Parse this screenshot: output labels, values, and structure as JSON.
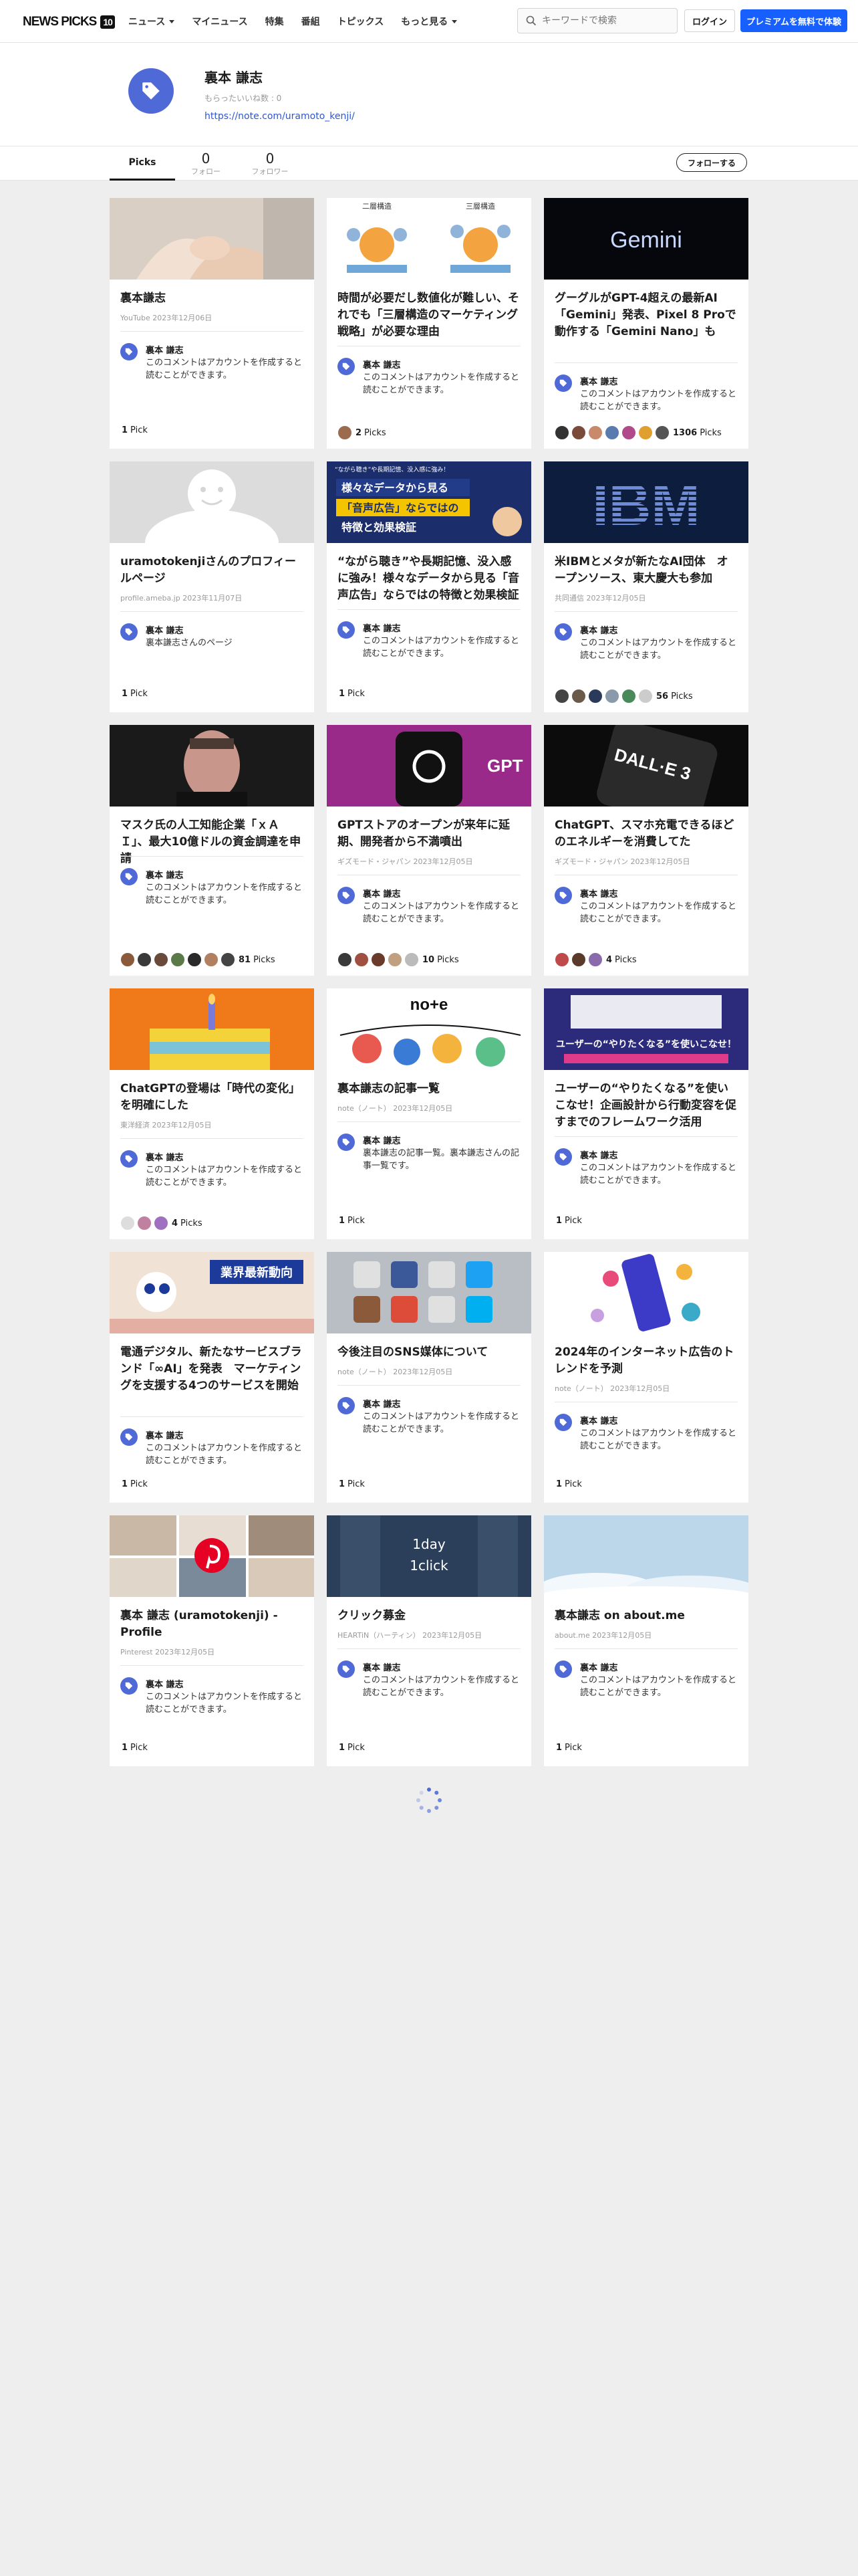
{
  "header": {
    "logo": "NEWS PICKS",
    "logo_badge": "10",
    "nav": [
      {
        "label": "ニュース",
        "dropdown": true
      },
      {
        "label": "マイニュース",
        "dropdown": false
      },
      {
        "label": "特集",
        "dropdown": false
      },
      {
        "label": "番組",
        "dropdown": false
      },
      {
        "label": "トピックス",
        "dropdown": false
      },
      {
        "label": "もっと見る",
        "dropdown": true
      }
    ],
    "search_placeholder": "キーワードで検索",
    "login": "ログイン",
    "premium": "プレミアムを無料で体験"
  },
  "profile": {
    "name": "裏本 謙志",
    "likes": "もらったいいね数 : 0",
    "link": "https://note.com/uramoto_kenji/"
  },
  "tabs": {
    "picks": "Picks",
    "following_count": "0",
    "following_label": "フォロー",
    "followers_count": "0",
    "followers_label": "フォロワー",
    "follow_button": "フォローする"
  },
  "colors": {
    "accent": "#1760ff",
    "avatar": "#4f69d6"
  },
  "cards": [
    {
      "title": "裏本謙志",
      "source": "YouTube 2023年12月06日",
      "commenter": "裏本 謙志",
      "comment": "このコメントはアカウントを作成すると読むことができます。",
      "picks": "1",
      "picks_suffix": "Pick",
      "thumb": "hands"
    },
    {
      "title": "時間が必要だし数値化が難しい、それでも「三層構造のマーケティング戦略」が必要な理由",
      "source": "",
      "commenter": "裏本 謙志",
      "comment": "このコメントはアカウントを作成すると読むことができます。",
      "picks": "2",
      "picks_suffix": "Picks",
      "thumb": "diagram"
    },
    {
      "title": "グーグルがGPT-4超えの最新AI「Gemini」発表、Pixel 8 Proで動作する「Gemini Nano」も",
      "source": "",
      "commenter": "裏本 謙志",
      "comment": "このコメントはアカウントを作成すると読むことができます。",
      "picks": "1306",
      "picks_suffix": "Picks",
      "thumb": "gemini"
    },
    {
      "title": "uramotokenjiさんのプロフィールページ",
      "source": "profile.ameba.jp 2023年11月07日",
      "commenter": "裏本 謙志",
      "comment": "裏本謙志さんのページ",
      "picks": "1",
      "picks_suffix": "Pick",
      "thumb": "face"
    },
    {
      "title": "“ながら聴き”や長期記憶、没入感に強み！様々なデータから見る「音声広告」ならではの特徴と効果検証",
      "source": "",
      "commenter": "裏本 謙志",
      "comment": "このコメントはアカウントを作成すると読むことができます。",
      "picks": "1",
      "picks_suffix": "Pick",
      "thumb": "audio"
    },
    {
      "title": "米IBMとメタが新たなAI団体　オープンソース、東大慶大も参加",
      "source": "共同通信 2023年12月05日",
      "commenter": "裏本 謙志",
      "comment": "このコメントはアカウントを作成すると読むことができます。",
      "picks": "56",
      "picks_suffix": "Picks",
      "thumb": "ibm"
    },
    {
      "title": "マスク氏の人工知能企業「ｘＡＩ」、最大10億ドルの資金調達を申請",
      "source": "",
      "commenter": "裏本 謙志",
      "comment": "このコメントはアカウントを作成すると読むことができます。",
      "picks": "81",
      "picks_suffix": "Picks",
      "thumb": "musk"
    },
    {
      "title": "GPTストアのオープンが来年に延期、開発者から不満噴出",
      "source": "ギズモード・ジャパン 2023年12月05日",
      "commenter": "裏本 謙志",
      "comment": "このコメントはアカウントを作成すると読むことができます。",
      "picks": "10",
      "picks_suffix": "Picks",
      "thumb": "gpt"
    },
    {
      "title": "ChatGPT、スマホ充電できるほどのエネルギーを消費してた",
      "source": "ギズモード・ジャパン 2023年12月05日",
      "commenter": "裏本 謙志",
      "comment": "このコメントはアカウントを作成すると読むことができます。",
      "picks": "4",
      "picks_suffix": "Picks",
      "thumb": "dalle"
    },
    {
      "title": "ChatGPTの登場は「時代の変化」を明確にした",
      "source": "東洋経済 2023年12月05日",
      "commenter": "裏本 謙志",
      "comment": "このコメントはアカウントを作成すると読むことができます。",
      "picks": "4",
      "picks_suffix": "Picks",
      "thumb": "cake"
    },
    {
      "title": "裏本謙志の記事一覧",
      "source": "note（ノート） 2023年12月05日",
      "commenter": "裏本 謙志",
      "comment": "裏本謙志の記事一覧。裏本謙志さんの記事一覧です。",
      "picks": "1",
      "picks_suffix": "Pick",
      "thumb": "note"
    },
    {
      "title": "ユーザーの“やりたくなる”を使いこなせ！企画設計から行動変容を促すまでのフレームワーク活用",
      "source": "",
      "commenter": "裏本 謙志",
      "comment": "このコメントはアカウントを作成すると読むことができます。",
      "picks": "1",
      "picks_suffix": "Pick",
      "thumb": "framework"
    },
    {
      "title": "電通デジタル、新たなサービスブランド「∞AI」を発表　マーケティングを支援する4つのサービスを開始",
      "source": "",
      "commenter": "裏本 謙志",
      "comment": "このコメントはアカウントを作成すると読むことができます。",
      "picks": "1",
      "picks_suffix": "Pick",
      "thumb": "trend"
    },
    {
      "title": "今後注目のSNS媒体について",
      "source": "note（ノート） 2023年12月05日",
      "commenter": "裏本 謙志",
      "comment": "このコメントはアカウントを作成すると読むことができます。",
      "picks": "1",
      "picks_suffix": "Pick",
      "thumb": "sns"
    },
    {
      "title": "2024年のインターネット広告のトレンドを予測",
      "source": "note（ノート） 2023年12月05日",
      "commenter": "裏本 謙志",
      "comment": "このコメントはアカウントを作成すると読むことができます。",
      "picks": "1",
      "picks_suffix": "Pick",
      "thumb": "phone"
    },
    {
      "title": "裏本 謙志 (uramotokenji) - Profile",
      "source": "Pinterest 2023年12月05日",
      "commenter": "裏本 謙志",
      "comment": "このコメントはアカウントを作成すると読むことができます。",
      "picks": "1",
      "picks_suffix": "Pick",
      "thumb": "pinterest"
    },
    {
      "title": "クリック募金",
      "source": "HEARTiN（ハーティン） 2023年12月05日",
      "commenter": "裏本 謙志",
      "comment": "このコメントはアカウントを作成すると読むことができます。",
      "picks": "1",
      "picks_suffix": "Pick",
      "thumb": "click"
    },
    {
      "title": "裏本謙志 on about.me",
      "source": "about.me 2023年12月05日",
      "commenter": "裏本 謙志",
      "comment": "このコメントはアカウントを作成すると読むことができます。",
      "picks": "1",
      "picks_suffix": "Pick",
      "thumb": "sky"
    }
  ],
  "thumb_text": {
    "diagram_left": "二層構造",
    "diagram_right": "三層構造",
    "gemini": "Gemini",
    "audio_top": "“ながら聴き”や長期記憶、没入感に強み！",
    "audio_line1": "様々なデータから見る",
    "audio_line2": "「音声広告」ならではの",
    "audio_line3": "特徴と効果検証",
    "ibm": "IBM",
    "gpt": "GPT",
    "dalle": "DALL·E 3",
    "note": "no+e",
    "framework": "ユーザーの“やりたくなる”を使いこなせ！",
    "trend": "業界最新動向",
    "click_line1": "1day",
    "click_line2": "1click"
  },
  "pick_avatars": [
    [],
    [
      "#9c6b4d"
    ],
    [
      "#333",
      "#7a4a3a",
      "#c98a6b",
      "#5a7bb0",
      "#b04a8a",
      "#e0a030",
      "#555"
    ],
    [],
    [],
    [
      "#444",
      "#6a5a4a",
      "#2a3a5a",
      "#8a9aaa",
      "#4a8a5a",
      "#ccc"
    ],
    [
      "#8a5a3a",
      "#3a3a3a",
      "#6a4a3a",
      "#5a7a4a",
      "#2a2a2a",
      "#b08060",
      "#444"
    ],
    [
      "#3a3a3a",
      "#a05040",
      "#6a3a2a",
      "#c0a080",
      "#bbb"
    ],
    [
      "#c04a4a",
      "#5a3a2a",
      "#8a6aaa"
    ],
    [
      "#ddd",
      "#c080a0",
      "#a070c0"
    ],
    [],
    [],
    [],
    [],
    [],
    [],
    [],
    []
  ]
}
